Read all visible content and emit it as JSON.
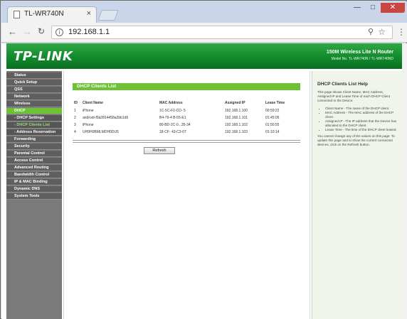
{
  "browser": {
    "tab_title": "TL-WR740N",
    "tab_close": "×",
    "url": "192.168.1.1",
    "controls": {
      "min": "—",
      "max": "□",
      "close": "✕"
    }
  },
  "header": {
    "logo": "TP-LINK",
    "product": "150M Wireless Lite N Router",
    "model": "Model No. TL-WR740N / TL-WR740ND"
  },
  "menu": {
    "items": [
      {
        "label": "Status",
        "type": "main"
      },
      {
        "label": "Quick Setup",
        "type": "main"
      },
      {
        "label": "QSS",
        "type": "main"
      },
      {
        "label": "Network",
        "type": "main"
      },
      {
        "label": "Wireless",
        "type": "main"
      },
      {
        "label": "DHCP",
        "type": "active"
      },
      {
        "label": "- DHCP Settings",
        "type": "sub"
      },
      {
        "label": "- DHCP Clients List",
        "type": "current"
      },
      {
        "label": "- Address Reservation",
        "type": "sub"
      },
      {
        "label": "Forwarding",
        "type": "main"
      },
      {
        "label": "Security",
        "type": "main"
      },
      {
        "label": "Parental Control",
        "type": "main"
      },
      {
        "label": "Access Control",
        "type": "main"
      },
      {
        "label": "Advanced Routing",
        "type": "main"
      },
      {
        "label": "Bandwidth Control",
        "type": "main"
      },
      {
        "label": "IP & MAC Binding",
        "type": "main"
      },
      {
        "label": "Dynamic DNS",
        "type": "main"
      },
      {
        "label": "System Tools",
        "type": "main"
      }
    ]
  },
  "main": {
    "title": "DHCP Clients List",
    "columns": [
      "ID",
      "Client Name",
      "MAC Address",
      "Assigned IP",
      "Lease Time"
    ],
    "rows": [
      [
        "1",
        "iPhone",
        "1C-5C-F2-CD-     5",
        "192.168.1.100",
        "00:59:22"
      ],
      [
        "2",
        "android-f0a2814458a2bb1d6",
        "B4-79-4     B-55-E1",
        "192.168.1.101",
        "01:45:05"
      ],
      [
        "3",
        "iPhone",
        "80-BD-2C-0...35-34",
        "192.168.1.102",
        "01:50:55"
      ],
      [
        "4",
        "UH9H0BMLMDH0DU5",
        "18-CF-    43-C3-07",
        "192.168.1.103",
        "01:10:14"
      ]
    ],
    "refresh_label": "Refresh"
  },
  "help": {
    "title": "DHCP Clients List Help",
    "intro": "This page shows Client Name, MAC Address, Assigned IP and Lease Time of each DHCP Client connected to the Device.",
    "items": [
      "Client Name - The name of the DHCP client.",
      "MAC Address - The MAC address of the DHCP client.",
      "Assigned IP - The IP address that the Device has allocated to the DHCP client.",
      "Lease Time - The time of the DHCP client leased."
    ],
    "outro": "You cannot change any of the values on this page. To update this page and to show the current connected devices, click on the Refresh button."
  }
}
